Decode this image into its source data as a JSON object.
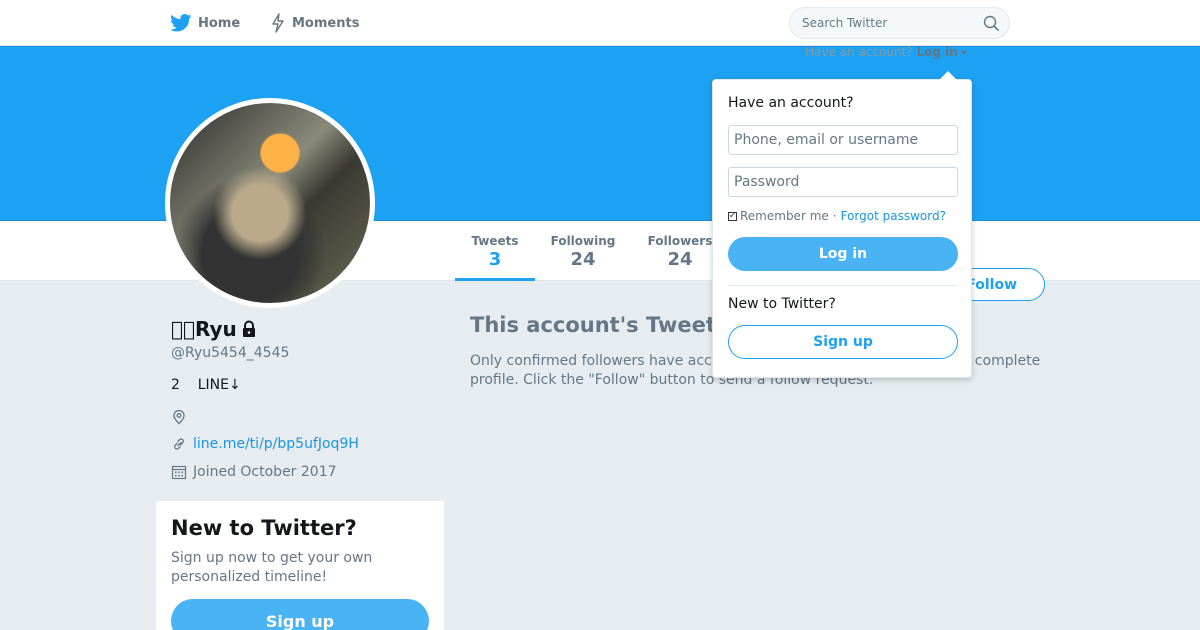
{
  "nav": {
    "home_label": "Home",
    "moments_label": "Moments",
    "search_placeholder": "Search Twitter"
  },
  "login_hint": {
    "text": "Have an account?",
    "link": "Log in"
  },
  "profile": {
    "name": "\u0000\u0000Ryu",
    "handle": "@Ryu5454_4545",
    "bio": "2    LINE↓",
    "location": "",
    "url": "line.me/ti/p/bp5ufJoq9H",
    "joined": "Joined October 2017",
    "protected": true
  },
  "stats": [
    {
      "label": "Tweets",
      "value": "3"
    },
    {
      "label": "Following",
      "value": "24"
    },
    {
      "label": "Followers",
      "value": "24"
    }
  ],
  "follow_button": "Follow",
  "protected_message": {
    "title": "This account's Tweets are protected.",
    "text": "Only confirmed followers have access to @Ryu5454_4545's Tweets and complete profile. Click the \"Follow\" button to send a follow request."
  },
  "signup_card": {
    "title": "New to Twitter?",
    "text": "Sign up now to get your own personalized timeline!",
    "button": "Sign up"
  },
  "login_dropdown": {
    "heading": "Have an account?",
    "username_placeholder": "Phone, email or username",
    "password_placeholder": "Password",
    "remember_label": "Remember me",
    "separator": "·",
    "forgot_label": "Forgot password?",
    "login_button": "Log in",
    "new_label": "New to Twitter?",
    "signup_button": "Sign up"
  },
  "colors": {
    "brand": "#1da1f2",
    "button": "#4ab3f4",
    "muted": "#657786",
    "background": "#e6ecf0"
  }
}
